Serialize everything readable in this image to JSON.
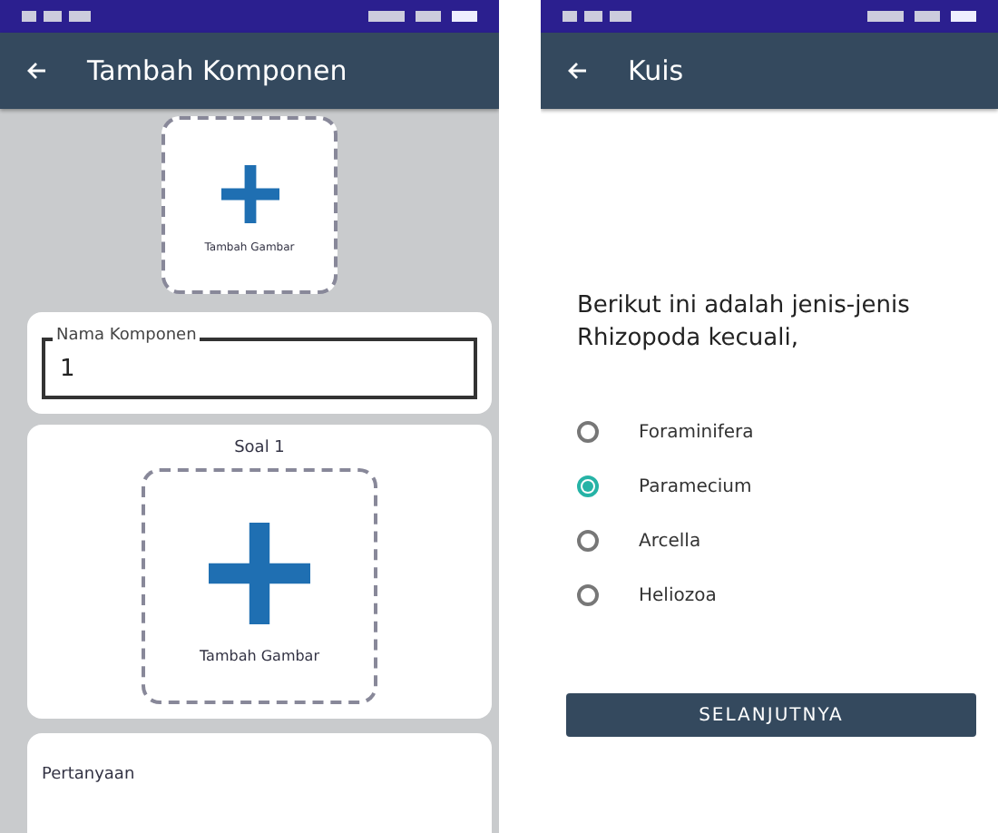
{
  "screens": [
    {
      "kind": "form",
      "title": "Tambah Komponen",
      "image_picker": {
        "label": "Tambah Gambar"
      },
      "field": {
        "label": "Nama Komponen",
        "value": "1"
      },
      "question_card": {
        "title": "Soal 1",
        "picker_label": "Tambah Gambar"
      },
      "next_card": {
        "label": "Pertanyaan"
      }
    },
    {
      "kind": "quiz",
      "title": "Kuis",
      "question": "Berikut ini adalah jenis-jenis Rhizopoda kecuali,",
      "options": [
        {
          "label": "Foraminifera",
          "selected": false
        },
        {
          "label": "Paramecium",
          "selected": true
        },
        {
          "label": "Arcella",
          "selected": false
        },
        {
          "label": "Heliozoa",
          "selected": false
        }
      ],
      "button": "SELANJUTNYA"
    }
  ]
}
